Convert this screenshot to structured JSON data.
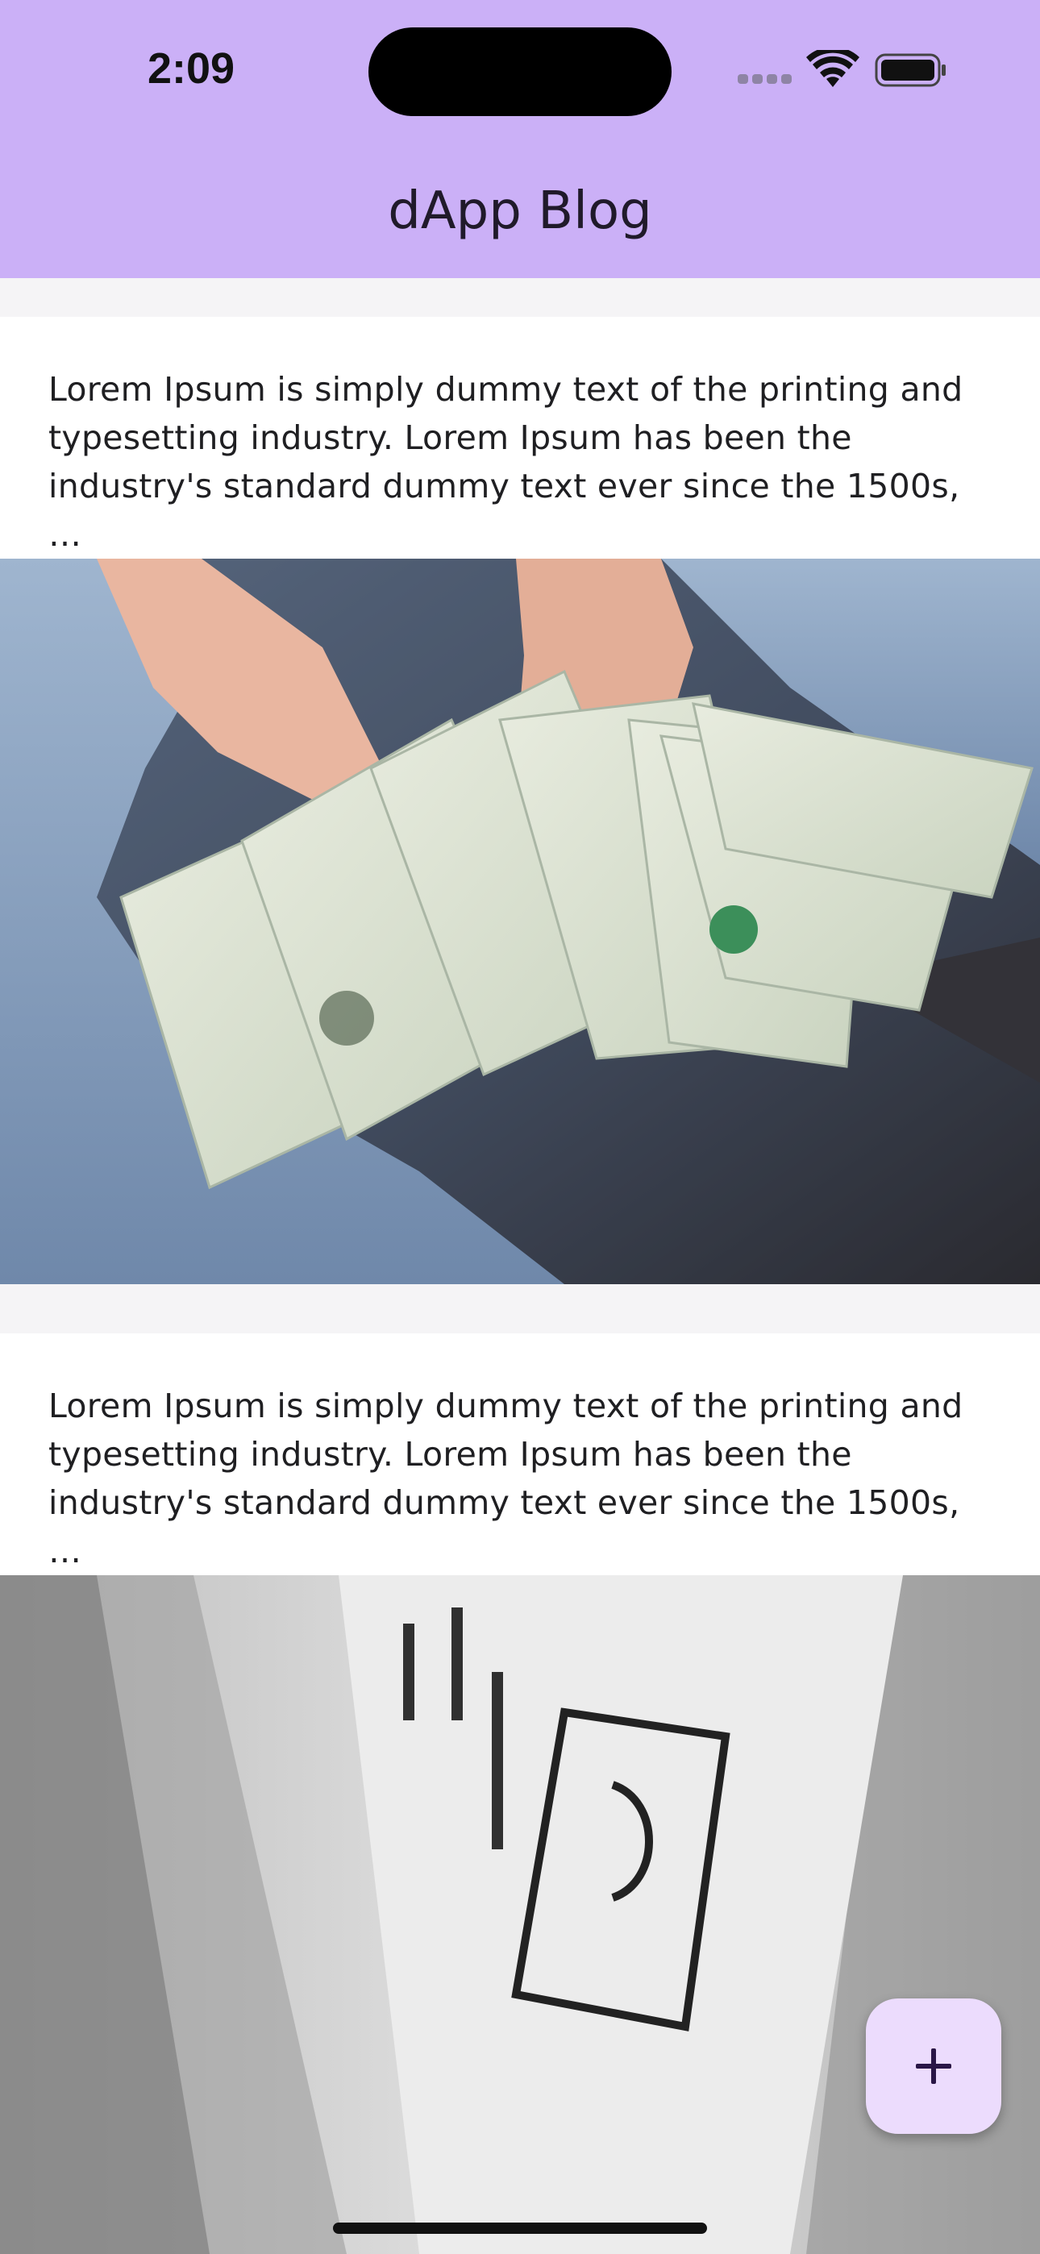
{
  "status_bar": {
    "time": "2:09",
    "signal_icon": "cellular-signal-icon",
    "wifi_icon": "wifi-icon",
    "battery_icon": "battery-icon"
  },
  "app_bar": {
    "title": "dApp Blog",
    "background_color": "#cbb0f7"
  },
  "posts": [
    {
      "text": "Lorem Ipsum is simply dummy text of the printing and typesetting industry. Lorem Ipsum has been the industry's standard dummy text ever since the 1500s, …",
      "image": "hands-holding-dollar-bills-photo"
    },
    {
      "text": "Lorem Ipsum is simply dummy text of the printing and typesetting industry. Lorem Ipsum has been the industry's standard dummy text ever since the 1500s, …",
      "image": "hundred-dollar-bill-closeup-photo"
    }
  ],
  "fab": {
    "icon": "plus-icon",
    "background_color": "#ecdcfd"
  }
}
